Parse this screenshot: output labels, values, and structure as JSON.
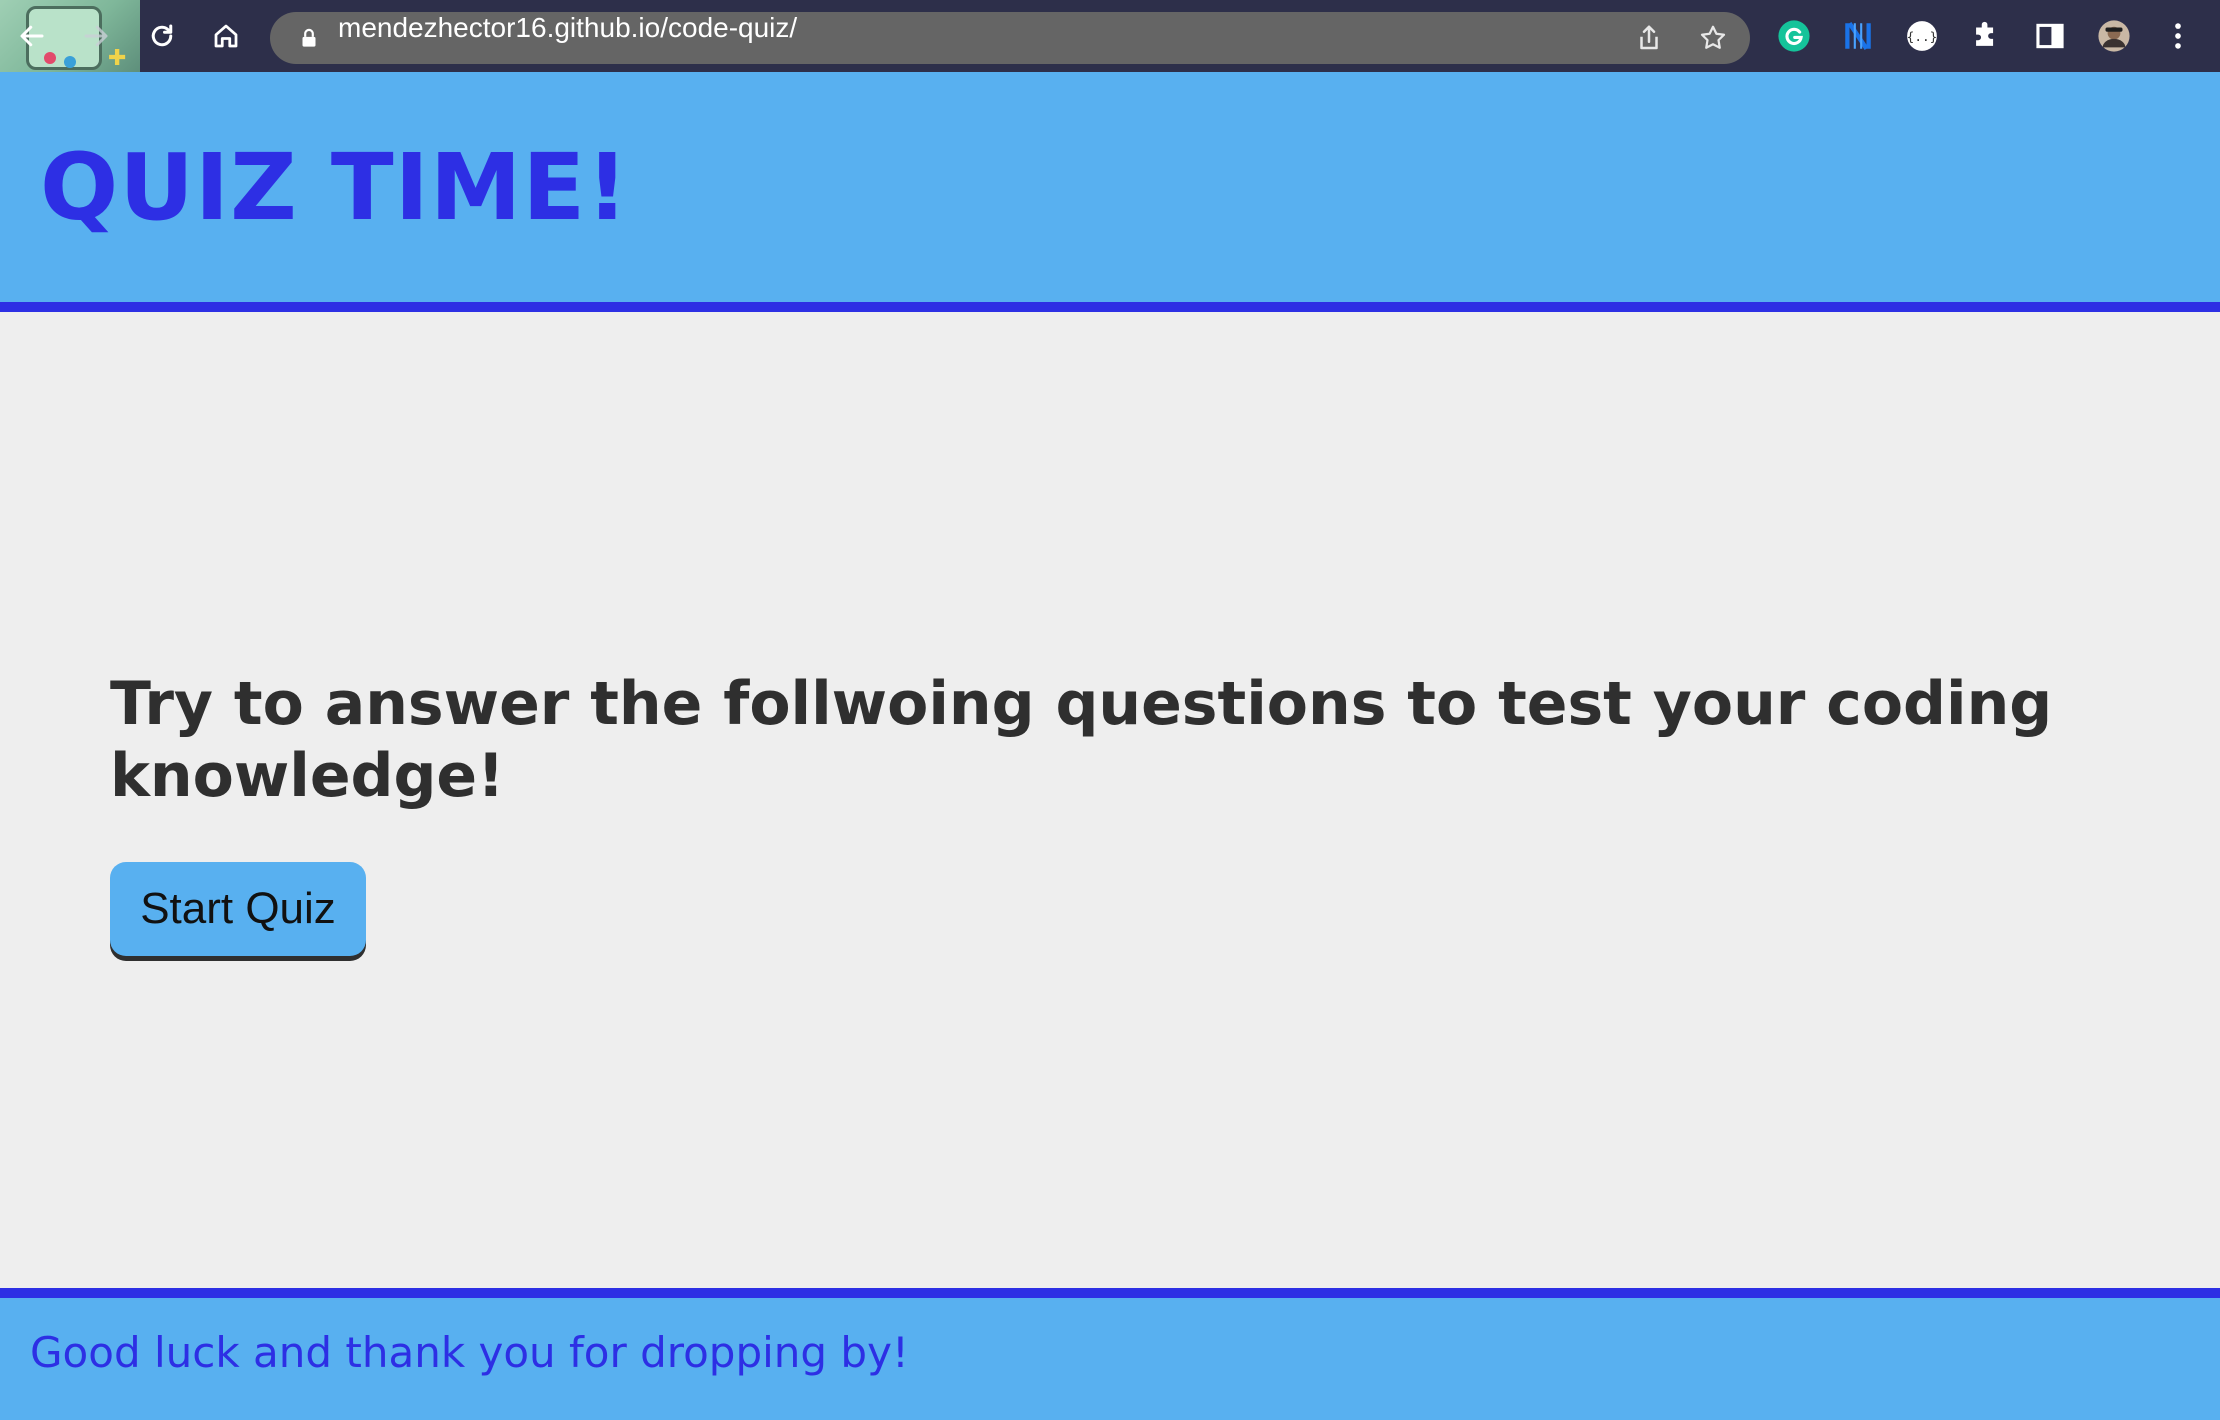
{
  "browser": {
    "url": "mendezhector16.github.io/code-quiz/",
    "colors": {
      "chrome_bg": "#2d2f4a",
      "omnibox_bg": "#656565"
    },
    "nav_icons": [
      "back-arrow-icon",
      "forward-arrow-icon",
      "reload-icon",
      "home-icon"
    ],
    "omnibox_icons": [
      "lock-icon",
      "share-icon",
      "bookmark-star-icon"
    ],
    "extension_icons": [
      "grammarly-icon",
      "n-extension-icon",
      "json-extension-icon",
      "puzzle-extensions-icon",
      "side-panel-icon",
      "profile-avatar-icon",
      "menu-kebab-icon"
    ]
  },
  "header": {
    "title": "QUIZ TIME!"
  },
  "main": {
    "intro": "Try to answer the follwoing questions to test your coding knowledge!",
    "start_button_label": "Start Quiz"
  },
  "footer": {
    "text": "Good luck and thank you for dropping by!"
  },
  "colors": {
    "accent_blue": "#58b0f0",
    "brand_indigo": "#2d2fe4",
    "page_bg": "#eeeeee",
    "body_text": "#2f2f2f"
  }
}
